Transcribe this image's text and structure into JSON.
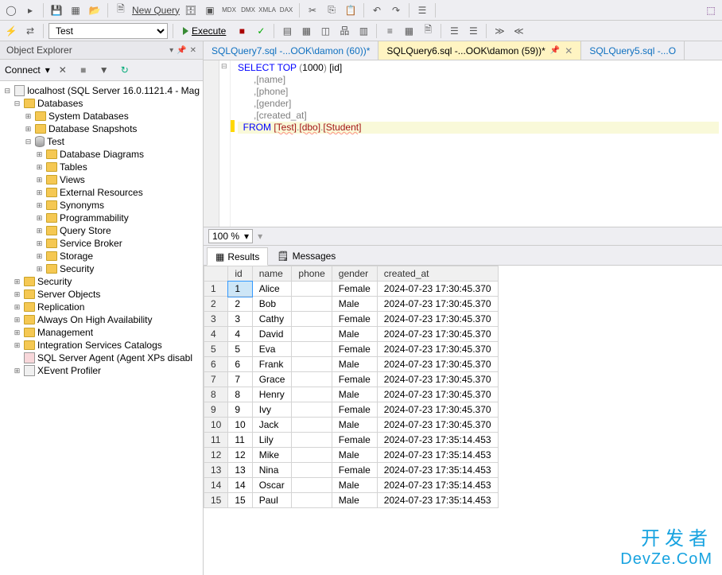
{
  "toolbar": {
    "new_query": "New Query",
    "db_selected": "Test",
    "execute_label": "Execute"
  },
  "object_explorer": {
    "title": "Object Explorer",
    "connect_label": "Connect",
    "server": "localhost (SQL Server 16.0.1121.4 - Mag",
    "root_databases": "Databases",
    "sys_db": "System Databases",
    "db_snap": "Database Snapshots",
    "test_db": "Test",
    "test_children": [
      "Database Diagrams",
      "Tables",
      "Views",
      "External Resources",
      "Synonyms",
      "Programmability",
      "Query Store",
      "Service Broker",
      "Storage",
      "Security"
    ],
    "top_nodes": [
      "Security",
      "Server Objects",
      "Replication",
      "Always On High Availability",
      "Management",
      "Integration Services Catalogs"
    ],
    "agent": "SQL Server Agent (Agent XPs disabl",
    "xevent": "XEvent Profiler"
  },
  "tabs": {
    "t1": "SQLQuery7.sql -...OOK\\damon (60))*",
    "t2": "SQLQuery6.sql -...OOK\\damon (59))*",
    "t3": "SQLQuery5.sql -...O"
  },
  "sql": {
    "l1a": "SELECT",
    "l1b": " TOP ",
    "l1c": "(",
    "l1d": "1000",
    "l1e": ")",
    "l1f": " [id]",
    "l2": "      ,[name]",
    "l3": "      ,[phone]",
    "l4": "      ,[gender]",
    "l5": "      ,[created_at]",
    "l6a": "  FROM ",
    "l6b": "[Test]",
    "l6c": ".",
    "l6d": "[dbo]",
    "l6e": ".",
    "l6f": "[Student]"
  },
  "zoom": "100 %",
  "results": {
    "tab_results": "Results",
    "tab_messages": "Messages",
    "columns": [
      "",
      "id",
      "name",
      "phone",
      "gender",
      "created_at"
    ],
    "rows": [
      [
        1,
        1,
        "Alice",
        "",
        "Female",
        "2024-07-23 17:30:45.370"
      ],
      [
        2,
        2,
        "Bob",
        "",
        "Male",
        "2024-07-23 17:30:45.370"
      ],
      [
        3,
        3,
        "Cathy",
        "",
        "Female",
        "2024-07-23 17:30:45.370"
      ],
      [
        4,
        4,
        "David",
        "",
        "Male",
        "2024-07-23 17:30:45.370"
      ],
      [
        5,
        5,
        "Eva",
        "",
        "Female",
        "2024-07-23 17:30:45.370"
      ],
      [
        6,
        6,
        "Frank",
        "",
        "Male",
        "2024-07-23 17:30:45.370"
      ],
      [
        7,
        7,
        "Grace",
        "",
        "Female",
        "2024-07-23 17:30:45.370"
      ],
      [
        8,
        8,
        "Henry",
        "",
        "Male",
        "2024-07-23 17:30:45.370"
      ],
      [
        9,
        9,
        "Ivy",
        "",
        "Female",
        "2024-07-23 17:30:45.370"
      ],
      [
        10,
        10,
        "Jack",
        "",
        "Male",
        "2024-07-23 17:30:45.370"
      ],
      [
        11,
        11,
        "Lily",
        "",
        "Female",
        "2024-07-23 17:35:14.453"
      ],
      [
        12,
        12,
        "Mike",
        "",
        "Male",
        "2024-07-23 17:35:14.453"
      ],
      [
        13,
        13,
        "Nina",
        "",
        "Female",
        "2024-07-23 17:35:14.453"
      ],
      [
        14,
        14,
        "Oscar",
        "",
        "Male",
        "2024-07-23 17:35:14.453"
      ],
      [
        15,
        15,
        "Paul",
        "",
        "Male",
        "2024-07-23 17:35:14.453"
      ]
    ]
  },
  "watermark": {
    "t1": "开发者",
    "t2": "DevZe.CoM"
  }
}
